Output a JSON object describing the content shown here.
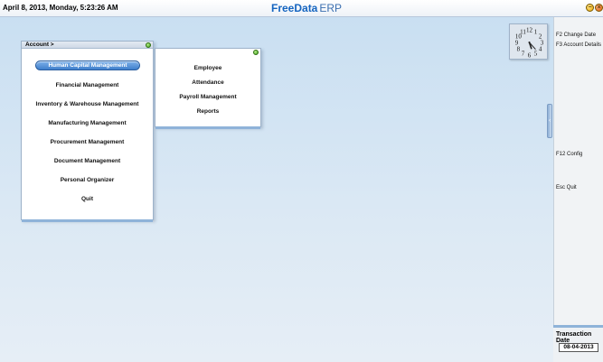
{
  "titlebar": {
    "datetime": "April  8, 2013, Monday, 5:23:26 AM",
    "brand_bold": "FreeData",
    "brand_rest": "ERP"
  },
  "main_menu": {
    "title": "Account >",
    "items": [
      {
        "label": "Human Capital Management",
        "selected": true
      },
      {
        "label": "Financial Management"
      },
      {
        "label": "Inventory & Warehouse Management"
      },
      {
        "label": "Manufacturing Management"
      },
      {
        "label": "Procurement Management"
      },
      {
        "label": "Document Management"
      },
      {
        "label": "Personal Organizer"
      },
      {
        "label": "Quit"
      }
    ]
  },
  "sub_menu": {
    "items": [
      {
        "label": "Employee"
      },
      {
        "label": "Attendance"
      },
      {
        "label": "Payroll Management"
      },
      {
        "label": "Reports"
      }
    ]
  },
  "clock": {
    "numerals": [
      "12",
      "1",
      "2",
      "3",
      "4",
      "5",
      "6",
      "7",
      "8",
      "9",
      "10",
      "11"
    ],
    "hour": 5,
    "minute": 23
  },
  "shortcuts": {
    "f2": "F2 Change Date",
    "f3": "F3 Account Details",
    "f12": "F12 Config",
    "esc": "Esc Quit"
  },
  "transaction": {
    "label": "Transaction Date",
    "value": "08-04-2013"
  },
  "colors": {
    "accent": "#1565c0",
    "selection": "#3f7fcc",
    "panel_border": "#8fb3d9"
  }
}
